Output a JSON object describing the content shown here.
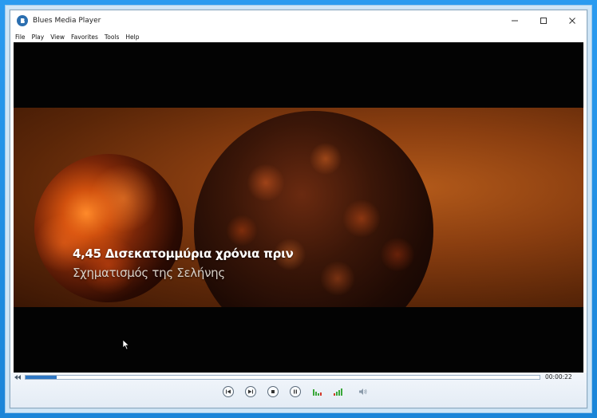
{
  "window": {
    "title": "Blues Media Player",
    "app_icon": "app-logo-icon"
  },
  "titlebar_buttons": {
    "minimize": "minimize-icon",
    "maximize": "maximize-icon",
    "close": "close-icon"
  },
  "menu": [
    "File",
    "Play",
    "View",
    "Favorites",
    "Tools",
    "Help"
  ],
  "video": {
    "subtitle_line1": "4,45 Δισεκατομμύρια χρόνια πριν",
    "subtitle_line2": "Σχηματισμός της Σελήνης"
  },
  "playback": {
    "elapsed": "00:00:22",
    "progress_fraction": 0.06
  },
  "controls": {
    "buttons": [
      "previous-icon",
      "next-icon",
      "stop-icon",
      "pause-icon",
      "equalizer-icon",
      "signal-level-icon",
      "volume-icon"
    ]
  },
  "colors": {
    "accent": "#2f78c4",
    "frame": "#1a8fe0",
    "eq_green": "#3aa83a",
    "eq_red": "#d03a2a"
  }
}
